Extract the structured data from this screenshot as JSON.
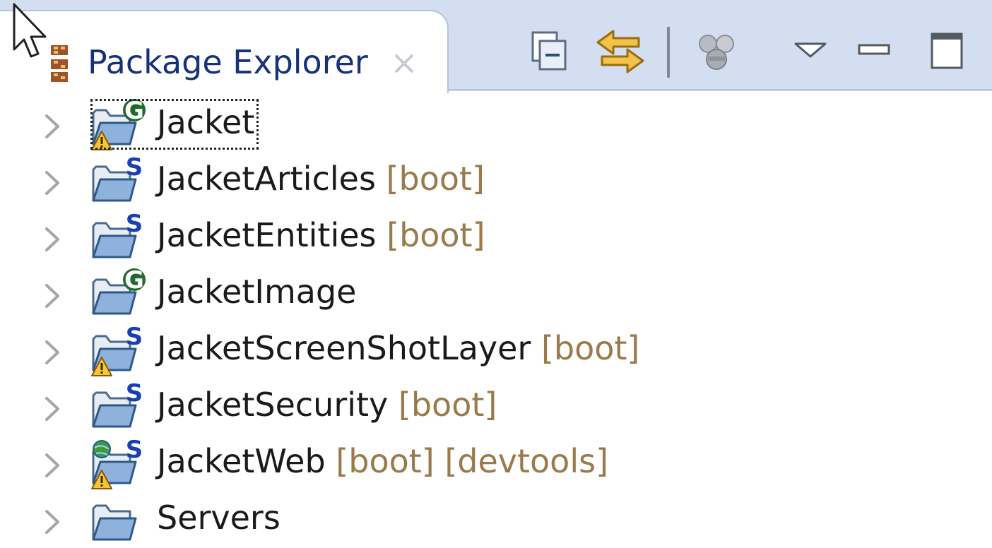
{
  "view": {
    "title": "Package Explorer",
    "icon": "package-explorer-icon",
    "close_icon": "close-icon"
  },
  "toolbar": {
    "items": [
      {
        "icon": "collapse-all-icon"
      },
      {
        "icon": "link-with-editor-icon"
      },
      {
        "icon": "select-working-set-icon"
      },
      {
        "icon": "view-menu-icon"
      },
      {
        "icon": "minimize-icon"
      },
      {
        "icon": "maximize-icon"
      }
    ]
  },
  "tree": {
    "items": [
      {
        "name": "Jacket",
        "decorations": "",
        "badge": "G",
        "warning": true,
        "web": false,
        "focused": true
      },
      {
        "name": "JacketArticles",
        "decorations": " [boot]",
        "badge": "S",
        "warning": false,
        "web": false,
        "focused": false
      },
      {
        "name": "JacketEntities",
        "decorations": " [boot]",
        "badge": "S",
        "warning": false,
        "web": false,
        "focused": false
      },
      {
        "name": "JacketImage",
        "decorations": "",
        "badge": "G",
        "warning": false,
        "web": false,
        "focused": false
      },
      {
        "name": "JacketScreenShotLayer",
        "decorations": " [boot]",
        "badge": "S",
        "warning": true,
        "web": false,
        "focused": false
      },
      {
        "name": "JacketSecurity",
        "decorations": " [boot]",
        "badge": "S",
        "warning": false,
        "web": false,
        "focused": false
      },
      {
        "name": "JacketWeb",
        "decorations": " [boot] [devtools]",
        "badge": "S",
        "warning": true,
        "web": true,
        "focused": false
      },
      {
        "name": "Servers",
        "decorations": "",
        "badge": "",
        "warning": false,
        "web": false,
        "focused": false
      }
    ]
  },
  "colors": {
    "header_bg": "#d3dff0",
    "title_text": "#16337a",
    "decoration_text": "#9a7a4a",
    "item_text": "#1a1a1a"
  }
}
